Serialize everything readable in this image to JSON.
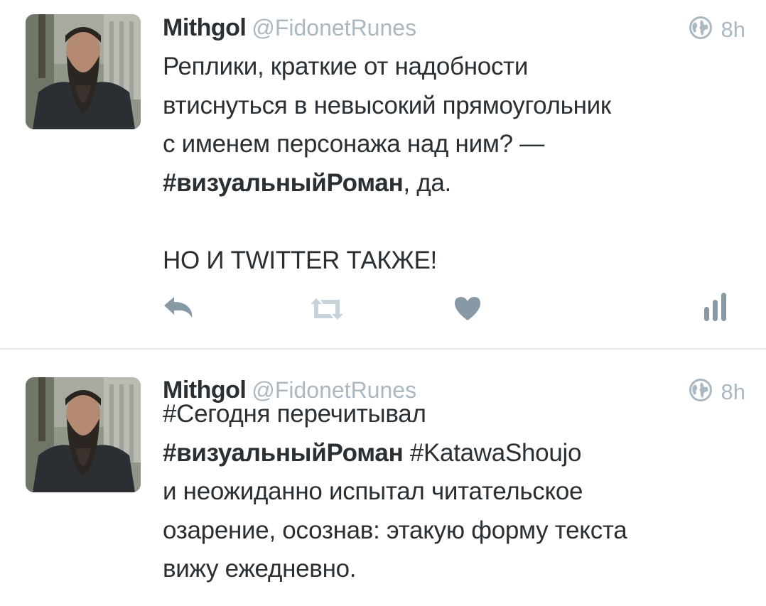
{
  "tweets": [
    {
      "display_name": "Mithgol",
      "handle": "@FidonetRunes",
      "time": "8h",
      "lines": [
        [
          {
            "t": "Реплики, краткие от надобности",
            "h": false
          }
        ],
        [
          {
            "t": "втиснуться в невысокий прямоугольник",
            "h": false
          }
        ],
        [
          {
            "t": "с именем персонажа над ним? —",
            "h": false
          }
        ],
        [
          {
            "t": "#визуальныйРоман",
            "h": true
          },
          {
            "t": ", да.",
            "h": false
          }
        ],
        [],
        [
          {
            "t": "НО И TWITTER ТАКЖЕ!",
            "h": false
          }
        ]
      ],
      "actions": [
        "reply-icon",
        "retweet-icon",
        "like-icon",
        "analytics-icon"
      ]
    },
    {
      "display_name": "Mithgol",
      "handle": "@FidonetRunes",
      "time": "8h",
      "lines": [
        [
          {
            "t": "#Сегодня перечитывал",
            "h": false
          }
        ],
        [
          {
            "t": "#визуальныйРоман",
            "h": true
          },
          {
            "t": " #KatawaShoujo",
            "h": false
          }
        ],
        [
          {
            "t": "и неожиданно испытал читательское",
            "h": false
          }
        ],
        [
          {
            "t": "озарение, осознав: этакую форму текста",
            "h": false
          }
        ],
        [
          {
            "t": "вижу ежедневно.",
            "h": false
          }
        ]
      ]
    }
  ],
  "colors": {
    "text": "#292f33",
    "muted": "#aab8c2",
    "icon": "#8899a6",
    "divider": "#e1e8ed"
  },
  "icons": {
    "globe": "globe-icon"
  }
}
